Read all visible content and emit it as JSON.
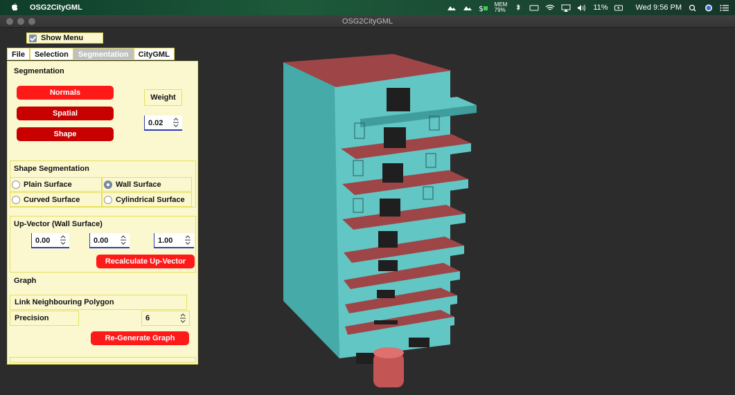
{
  "menubar": {
    "app_name": "OSG2CityGML",
    "mem_label": "MEM",
    "mem_value": "79%",
    "battery": "11%",
    "clock": "Wed 9:56 PM"
  },
  "window": {
    "title": "OSG2CityGML"
  },
  "show_menu": {
    "label": "Show Menu",
    "checked": true
  },
  "tabs": [
    {
      "label": "File",
      "active": false
    },
    {
      "label": "Selection",
      "active": false
    },
    {
      "label": "Segmentation",
      "active": true
    },
    {
      "label": "CityGML",
      "active": false
    }
  ],
  "segmentation": {
    "title": "Segmentation",
    "buttons": {
      "normals": "Normals",
      "spatial": "Spatial",
      "shape": "Shape"
    },
    "weight_label": "Weight",
    "weight_value": "0.02"
  },
  "shape_segmentation": {
    "title": "Shape Segmentation",
    "options": {
      "plain": "Plain Surface",
      "wall": "Wall Surface",
      "curved": "Curved Surface",
      "cylindrical": "Cylindrical Surface"
    },
    "selected": "Wall Surface"
  },
  "up_vector": {
    "title": "Up-Vector (Wall Surface)",
    "x": "0.00",
    "y": "0.00",
    "z": "1.00",
    "recalculate_label": "Recalculate Up-Vector"
  },
  "graph": {
    "title": "Graph",
    "link_label": "Link Neighbouring Polygon",
    "precision_label": "Precision",
    "precision_value": "6",
    "regenerate_label": "Re-Generate Graph"
  },
  "colors": {
    "wall": "#62c6c4",
    "wall_dark": "#3f9e9d",
    "roof": "#9e4547",
    "panel_bg": "#fbf8cf",
    "button_red": "#ff1a1a",
    "button_dark_red": "#c80000"
  }
}
